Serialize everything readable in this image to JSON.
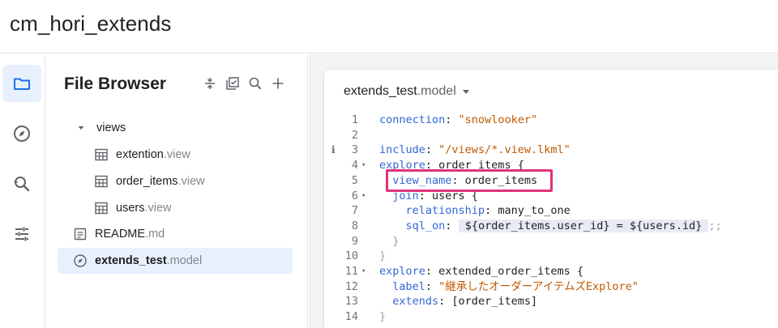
{
  "app": {
    "title": "cm_hori_extends"
  },
  "rail": {
    "items": [
      {
        "name": "folder-icon",
        "active": true
      },
      {
        "name": "compass-icon",
        "active": false
      },
      {
        "name": "search-history-icon",
        "active": false
      },
      {
        "name": "sliders-icon",
        "active": false
      }
    ]
  },
  "file_browser": {
    "title": "File Browser",
    "tools": [
      "collapse-icon",
      "multiselect-icon",
      "search-icon",
      "add-icon"
    ],
    "tree": [
      {
        "name": "views",
        "ext": "",
        "type": "folder",
        "level": 0,
        "expanded": true
      },
      {
        "name": "extention",
        "ext": ".view",
        "type": "view",
        "level": 1
      },
      {
        "name": "order_items",
        "ext": ".view",
        "type": "view",
        "level": 1
      },
      {
        "name": "users",
        "ext": ".view",
        "type": "view",
        "level": 1
      },
      {
        "name": "README",
        "ext": ".md",
        "type": "doc",
        "level": 0
      },
      {
        "name": "extends_test",
        "ext": ".model",
        "type": "model",
        "level": 0,
        "selected": true
      }
    ]
  },
  "editor": {
    "tab_name": "extends_test",
    "tab_ext": ".model",
    "lines": [
      {
        "n": "1",
        "tokens": [
          [
            "k",
            "connection"
          ],
          [
            "p",
            ": "
          ],
          [
            "s",
            "\"snowlooker\""
          ]
        ]
      },
      {
        "n": "2",
        "tokens": []
      },
      {
        "n": "3",
        "info": "i",
        "tokens": [
          [
            "k",
            "include"
          ],
          [
            "p",
            ": "
          ],
          [
            "s",
            "\"/views/*.view.lkml\""
          ]
        ]
      },
      {
        "n": "4",
        "fold": "▾",
        "tokens": [
          [
            "k",
            "explore"
          ],
          [
            "p",
            ": order_items {"
          ]
        ]
      },
      {
        "n": "5",
        "tokens": [
          [
            "p",
            "  "
          ],
          [
            "k",
            "view_name"
          ],
          [
            "p",
            ": order_items"
          ]
        ]
      },
      {
        "n": "6",
        "fold": "▾",
        "tokens": [
          [
            "p",
            "  "
          ],
          [
            "k",
            "join"
          ],
          [
            "p",
            ": users {"
          ]
        ]
      },
      {
        "n": "7",
        "tokens": [
          [
            "p",
            "    "
          ],
          [
            "k",
            "relationship"
          ],
          [
            "p",
            ": many_to_one"
          ]
        ]
      },
      {
        "n": "8",
        "tokens": [
          [
            "p",
            "    "
          ],
          [
            "k",
            "sql_on"
          ],
          [
            "p",
            ": "
          ],
          [
            "hl",
            " ${order_items.user_id} = ${users.id} "
          ],
          [
            "dim",
            ";;"
          ]
        ]
      },
      {
        "n": "9",
        "tokens": [
          [
            "p",
            "  "
          ],
          [
            "dim",
            "}"
          ]
        ]
      },
      {
        "n": "10",
        "tokens": [
          [
            "dim",
            "}"
          ]
        ]
      },
      {
        "n": "11",
        "fold": "▾",
        "tokens": [
          [
            "k",
            "explore"
          ],
          [
            "p",
            ": extended_order_items {"
          ]
        ]
      },
      {
        "n": "12",
        "tokens": [
          [
            "p",
            "  "
          ],
          [
            "k",
            "label"
          ],
          [
            "p",
            ": "
          ],
          [
            "s",
            "\"継承したオーダーアイテムズExplore\""
          ]
        ]
      },
      {
        "n": "13",
        "tokens": [
          [
            "p",
            "  "
          ],
          [
            "k",
            "extends"
          ],
          [
            "p",
            ": [order_items]"
          ]
        ]
      },
      {
        "n": "14",
        "tokens": [
          [
            "dim",
            "}"
          ]
        ]
      }
    ]
  },
  "colors": {
    "accent": "#e0327b",
    "keyword": "#3367d6",
    "string": "#c05a00",
    "selected_bg": "#e8f0fe"
  }
}
